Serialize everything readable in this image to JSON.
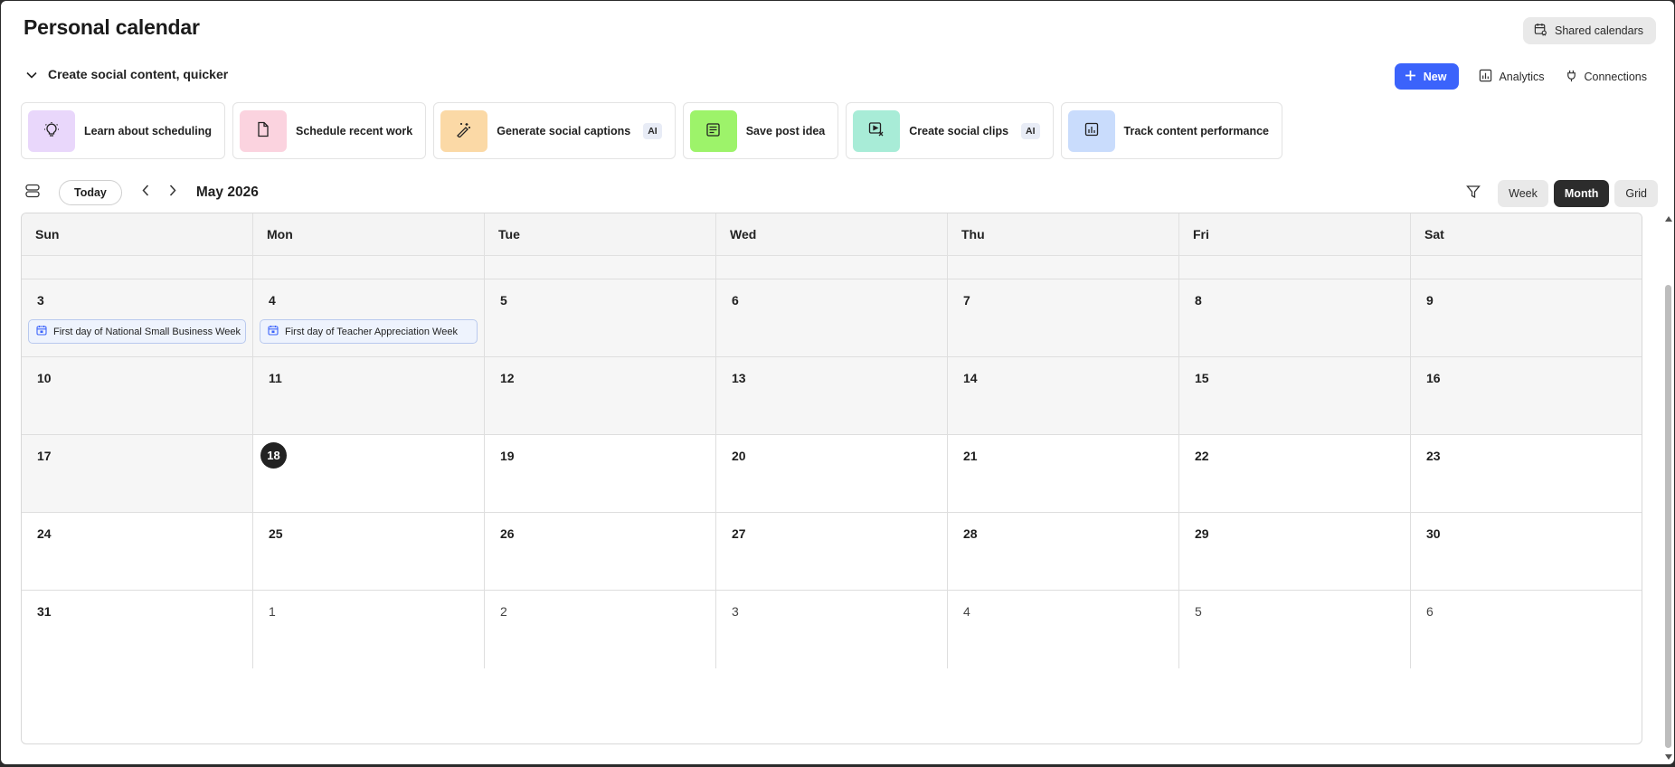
{
  "page": {
    "title": "Personal calendar"
  },
  "header": {
    "shared_calendars_label": "Shared calendars",
    "collapse_label": "Create social content, quicker",
    "new_label": "New",
    "analytics_label": "Analytics",
    "connections_label": "Connections"
  },
  "quick_actions": [
    {
      "label": "Learn about scheduling",
      "icon": "lightbulb-icon",
      "color": "#e9d7fb"
    },
    {
      "label": "Schedule recent work",
      "icon": "document-icon",
      "color": "#fbd3df"
    },
    {
      "label": "Generate social captions",
      "icon": "magic-wand-icon",
      "color": "#fbd9a6",
      "badge": "AI"
    },
    {
      "label": "Save post idea",
      "icon": "post-idea-icon",
      "color": "#9df36a"
    },
    {
      "label": "Create social clips",
      "icon": "video-clip-icon",
      "color": "#a8ecd7",
      "badge": "AI"
    },
    {
      "label": "Track content performance",
      "icon": "chart-icon",
      "color": "#c9dcfc"
    }
  ],
  "toolbar": {
    "today_label": "Today",
    "month_label": "May 2026",
    "views": [
      "Week",
      "Month",
      "Grid"
    ],
    "active_view": "Month"
  },
  "calendar": {
    "weekdays": [
      "Sun",
      "Mon",
      "Tue",
      "Wed",
      "Thu",
      "Fri",
      "Sat"
    ],
    "weeks": [
      [
        {
          "d": "",
          "p": 1
        },
        {
          "d": "",
          "p": 1
        },
        {
          "d": "",
          "p": 1
        },
        {
          "d": "",
          "p": 1
        },
        {
          "d": "",
          "p": 1
        },
        {
          "d": "",
          "p": 1
        },
        {
          "d": "",
          "p": 1
        }
      ],
      [
        {
          "d": "3",
          "p": 1,
          "event": "First day of National Small Business Week"
        },
        {
          "d": "4",
          "p": 1,
          "event": "First day of Teacher Appreciation Week"
        },
        {
          "d": "5",
          "p": 1
        },
        {
          "d": "6",
          "p": 1
        },
        {
          "d": "7",
          "p": 1
        },
        {
          "d": "8",
          "p": 1
        },
        {
          "d": "9",
          "p": 1
        }
      ],
      [
        {
          "d": "10",
          "p": 1
        },
        {
          "d": "11",
          "p": 1
        },
        {
          "d": "12",
          "p": 1
        },
        {
          "d": "13",
          "p": 1
        },
        {
          "d": "14",
          "p": 1
        },
        {
          "d": "15",
          "p": 1
        },
        {
          "d": "16",
          "p": 1
        }
      ],
      [
        {
          "d": "17",
          "p": 1
        },
        {
          "d": "18",
          "today": 1
        },
        {
          "d": "19"
        },
        {
          "d": "20"
        },
        {
          "d": "21"
        },
        {
          "d": "22"
        },
        {
          "d": "23"
        }
      ],
      [
        {
          "d": "24"
        },
        {
          "d": "25"
        },
        {
          "d": "26"
        },
        {
          "d": "27"
        },
        {
          "d": "28"
        },
        {
          "d": "29"
        },
        {
          "d": "30"
        }
      ],
      [
        {
          "d": "31"
        },
        {
          "d": "1",
          "dim": 1
        },
        {
          "d": "2",
          "dim": 1
        },
        {
          "d": "3",
          "dim": 1
        },
        {
          "d": "4",
          "dim": 1
        },
        {
          "d": "5",
          "dim": 1
        },
        {
          "d": "6",
          "dim": 1
        }
      ]
    ]
  }
}
